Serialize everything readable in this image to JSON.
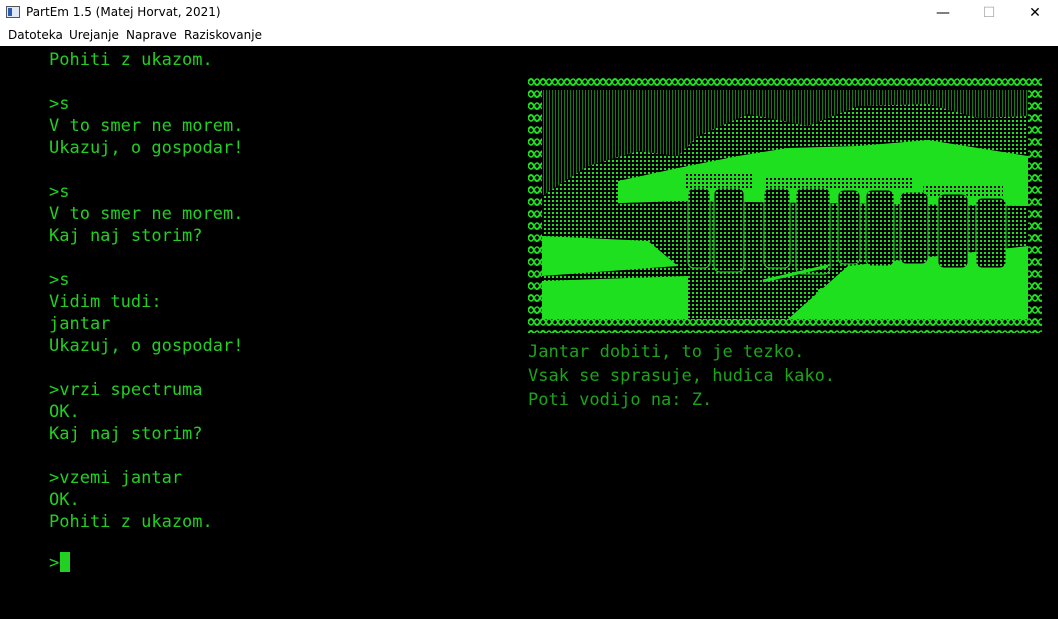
{
  "window": {
    "title": "PartEm 1.5 (Matej Horvat, 2021)",
    "minimize_glyph": "—",
    "maximize_glyph": "☐",
    "close_glyph": "✕"
  },
  "menu": {
    "items": [
      "Datoteka",
      "Urejanje",
      "Naprave",
      "Raziskovanje"
    ]
  },
  "console": {
    "lines": [
      "Pohiti z ukazom.",
      "",
      ">s",
      "V to smer ne morem.",
      "Ukazuj, o gospodar!",
      "",
      ">s",
      "V to smer ne morem.",
      "Kaj naj storim?",
      "",
      ">s",
      "Vidim tudi:",
      "jantar",
      "Ukazuj, o gospodar!",
      "",
      ">vrzi spectruma",
      "OK.",
      "Kaj naj storim?",
      "",
      ">vzemi jantar",
      "OK.",
      "Pohiti z ukazom."
    ],
    "prompt": ">"
  },
  "scene": {
    "caption_lines": [
      "Jantar dobiti, to je tezko.",
      "Vsak se sprasuje, hudica kako.",
      "Poti vodijo na: Z."
    ]
  },
  "colors": {
    "screen_bg": "#000000",
    "text_green": "#22d022",
    "caption_green": "#1aa51a",
    "scene_green": "#1ee01e",
    "scene_dark": "#0a5a0a"
  }
}
